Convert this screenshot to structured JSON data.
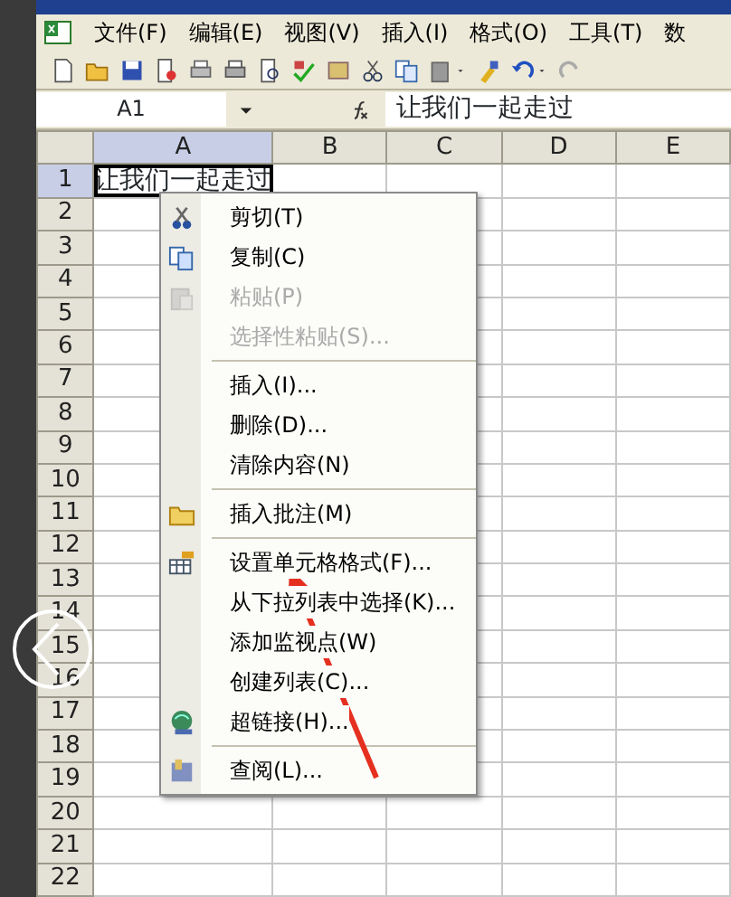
{
  "menu_bar": [
    {
      "label": "文件(F)"
    },
    {
      "label": "编辑(E)"
    },
    {
      "label": "视图(V)"
    },
    {
      "label": "插入(I)"
    },
    {
      "label": "格式(O)"
    },
    {
      "label": "工具(T)"
    },
    {
      "label": "数"
    }
  ],
  "name_box": "A1",
  "formula": "让我们一起走过",
  "columns": [
    {
      "label": "A",
      "selected": true
    },
    {
      "label": "B",
      "selected": false
    },
    {
      "label": "C",
      "selected": false
    },
    {
      "label": "D",
      "selected": false
    },
    {
      "label": "E",
      "selected": false
    }
  ],
  "rows": [
    {
      "label": "1",
      "selected": true,
      "value": "让我们一起走过"
    },
    {
      "label": "2",
      "selected": false
    },
    {
      "label": "3",
      "selected": false
    },
    {
      "label": "4",
      "selected": false
    },
    {
      "label": "5",
      "selected": false
    },
    {
      "label": "6",
      "selected": false
    },
    {
      "label": "7",
      "selected": false
    },
    {
      "label": "8",
      "selected": false
    },
    {
      "label": "9",
      "selected": false
    },
    {
      "label": "10",
      "selected": false
    },
    {
      "label": "11",
      "selected": false
    },
    {
      "label": "12",
      "selected": false
    },
    {
      "label": "13",
      "selected": false
    },
    {
      "label": "14",
      "selected": false
    },
    {
      "label": "15",
      "selected": false
    },
    {
      "label": "16",
      "selected": false
    },
    {
      "label": "17",
      "selected": false
    },
    {
      "label": "18",
      "selected": false
    },
    {
      "label": "19",
      "selected": false
    },
    {
      "label": "20",
      "selected": false
    },
    {
      "label": "21",
      "selected": false
    },
    {
      "label": "22",
      "selected": false
    }
  ],
  "context_menu": [
    {
      "kind": "item",
      "label": "剪切(T)",
      "disabled": false
    },
    {
      "kind": "item",
      "label": "复制(C)",
      "disabled": false
    },
    {
      "kind": "item",
      "label": "粘贴(P)",
      "disabled": true
    },
    {
      "kind": "item",
      "label": "选择性粘贴(S)...",
      "disabled": true
    },
    {
      "kind": "separator"
    },
    {
      "kind": "item",
      "label": "插入(I)...",
      "disabled": false
    },
    {
      "kind": "item",
      "label": "删除(D)...",
      "disabled": false
    },
    {
      "kind": "item",
      "label": "清除内容(N)",
      "disabled": false
    },
    {
      "kind": "separator"
    },
    {
      "kind": "item",
      "label": "插入批注(M)",
      "disabled": false
    },
    {
      "kind": "separator"
    },
    {
      "kind": "item",
      "label": "设置单元格格式(F)...",
      "disabled": false
    },
    {
      "kind": "item",
      "label": "从下拉列表中选择(K)...",
      "disabled": false
    },
    {
      "kind": "item",
      "label": "添加监视点(W)",
      "disabled": false
    },
    {
      "kind": "item",
      "label": "创建列表(C)...",
      "disabled": false
    },
    {
      "kind": "item",
      "label": "超链接(H)...",
      "disabled": false
    },
    {
      "kind": "separator"
    },
    {
      "kind": "item",
      "label": "查阅(L)...",
      "disabled": false
    }
  ]
}
